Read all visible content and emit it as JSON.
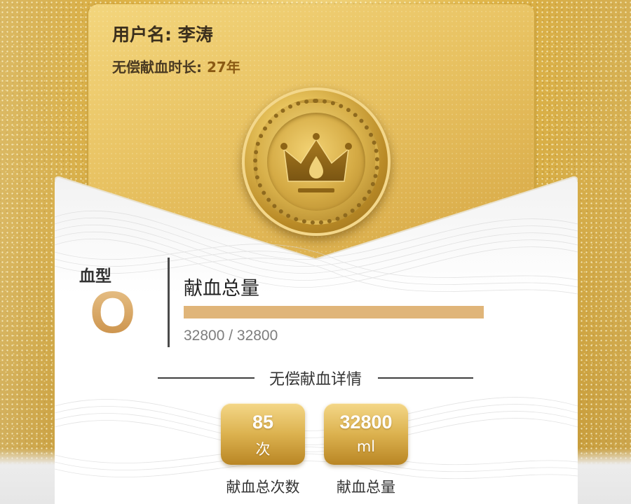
{
  "user": {
    "name_label": "用户名:",
    "name_value": "李涛",
    "duration_label": "无偿献血时长:",
    "duration_value": "27年"
  },
  "medal": {
    "icon": "crown-with-blood-drop-icon"
  },
  "blood_type": {
    "label": "血型",
    "value": "O"
  },
  "total_volume": {
    "label": "献血总量",
    "current": 32800,
    "target": 32800,
    "progress_text": "32800 / 32800",
    "progress_fraction": 1.0
  },
  "details": {
    "title": "无偿献血详情",
    "stats": [
      {
        "value": "85",
        "unit": "次",
        "caption": "献血总次数"
      },
      {
        "value": "32800",
        "unit": "ml",
        "caption": "献血总量"
      }
    ]
  },
  "colors": {
    "gold_background": "#e2b84c",
    "blood_type_gradient": "#d3a25d",
    "progress_fill": "#e0b579",
    "progress_track": "#efe3cf",
    "stat_box_gold": "#dcb24f",
    "text_dark": "#333333"
  }
}
